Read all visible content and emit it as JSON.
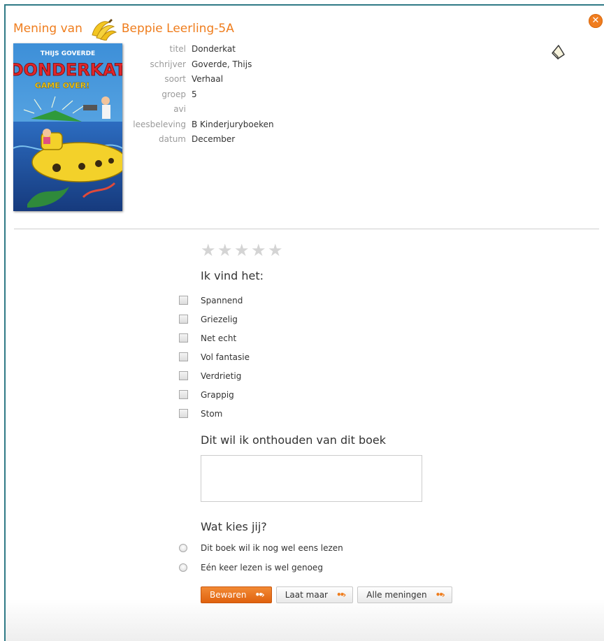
{
  "header": {
    "title_prefix": "Mening van",
    "student_name": "Beppie Leerling-5A"
  },
  "close_icon": "close-icon",
  "book": {
    "cover": {
      "author": "THIJS GOVERDE",
      "title": "DONDERKAT",
      "subtitle": "GAME OVER!"
    },
    "fields": [
      {
        "label": "titel",
        "value": "Donderkat"
      },
      {
        "label": "schrijver",
        "value": "Goverde, Thijs"
      },
      {
        "label": "soort",
        "value": "Verhaal"
      },
      {
        "label": "groep",
        "value": "5"
      },
      {
        "label": "avi",
        "value": ""
      },
      {
        "label": "leesbeleving",
        "value": "B Kinderjuryboeken"
      },
      {
        "label": "datum",
        "value": "December"
      }
    ]
  },
  "rating": {
    "stars_filled": 0,
    "stars_total": 5
  },
  "feelings": {
    "heading": "Ik vind het:",
    "options": [
      "Spannend",
      "Griezelig",
      "Net echt",
      "Vol fantasie",
      "Verdrietig",
      "Grappig",
      "Stom"
    ]
  },
  "remember": {
    "heading": "Dit wil ik onthouden van dit boek",
    "value": ""
  },
  "choice": {
    "heading": "Wat kies jij?",
    "options": [
      "Dit boek wil ik nog wel eens lezen",
      "Eén keer lezen is wel genoeg"
    ]
  },
  "buttons": {
    "save": "Bewaren",
    "cancel": "Laat maar",
    "all": "Alle meningen"
  },
  "colors": {
    "accent": "#ef7d1d",
    "frame": "#2f7a86"
  }
}
